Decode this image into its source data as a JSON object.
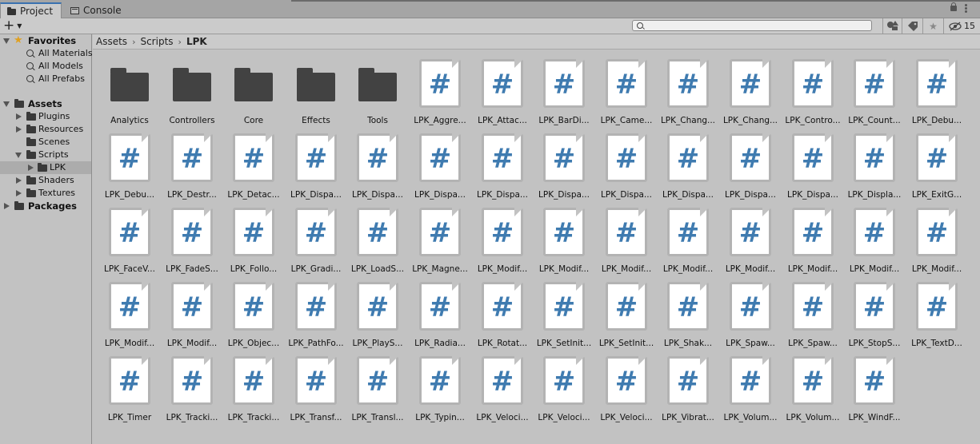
{
  "tabs": [
    {
      "label": "Project",
      "icon": "folder-icon",
      "active": true
    },
    {
      "label": "Console",
      "icon": "console-icon",
      "active": false
    }
  ],
  "toolbar": {
    "add_label": "+",
    "search_placeholder": "",
    "hidden_count": "15"
  },
  "tree": {
    "favorites": {
      "label": "Favorites",
      "items": [
        "All Materials",
        "All Models",
        "All Prefabs"
      ]
    },
    "assets": {
      "label": "Assets",
      "children": [
        "Plugins",
        "Resources",
        "Scenes",
        "Scripts",
        "LPK",
        "Shaders",
        "Textures"
      ]
    },
    "packages": {
      "label": "Packages"
    }
  },
  "breadcrumb": [
    "Assets",
    "Scripts",
    "LPK"
  ],
  "grid": {
    "folders": [
      "Analytics",
      "Controllers",
      "Core",
      "Effects",
      "Tools"
    ],
    "scripts": [
      "LPK_Aggre...",
      "LPK_Attac...",
      "LPK_BarDi...",
      "LPK_Came...",
      "LPK_Chang...",
      "LPK_Chang...",
      "LPK_Contro...",
      "LPK_Count...",
      "LPK_Debu...",
      "LPK_Debu...",
      "LPK_Destr...",
      "LPK_Detac...",
      "LPK_Dispa...",
      "LPK_Dispa...",
      "LPK_Dispa...",
      "LPK_Dispa...",
      "LPK_Dispa...",
      "LPK_Dispa...",
      "LPK_Dispa...",
      "LPK_Dispa...",
      "LPK_Dispa...",
      "LPK_Displa...",
      "LPK_ExitG...",
      "LPK_FaceV...",
      "LPK_FadeS...",
      "LPK_Follo...",
      "LPK_Gradi...",
      "LPK_LoadS...",
      "LPK_Magne...",
      "LPK_Modif...",
      "LPK_Modif...",
      "LPK_Modif...",
      "LPK_Modif...",
      "LPK_Modif...",
      "LPK_Modif...",
      "LPK_Modif...",
      "LPK_Modif...",
      "LPK_Modif...",
      "LPK_Modif...",
      "LPK_Objec...",
      "LPK_PathFo...",
      "LPK_PlayS...",
      "LPK_Radia...",
      "LPK_Rotat...",
      "LPK_SetInit...",
      "LPK_SetInit...",
      "LPK_Shak...",
      "LPK_Spaw...",
      "LPK_Spaw...",
      "LPK_StopS...",
      "LPK_TextD...",
      "LPK_Timer",
      "LPK_Tracki...",
      "LPK_Tracki...",
      "LPK_Transf...",
      "LPK_Transl...",
      "LPK_Typin...",
      "LPK_Veloci...",
      "LPK_Veloci...",
      "LPK_Veloci...",
      "LPK_Vibrat...",
      "LPK_Volum...",
      "LPK_Volum...",
      "LPK_WindF..."
    ],
    "script_glyph": "#"
  },
  "colors": {
    "accent": "#3a72b0",
    "script_hash": "#3f7bb0",
    "folder": "#424242",
    "star": "#e0a020"
  }
}
